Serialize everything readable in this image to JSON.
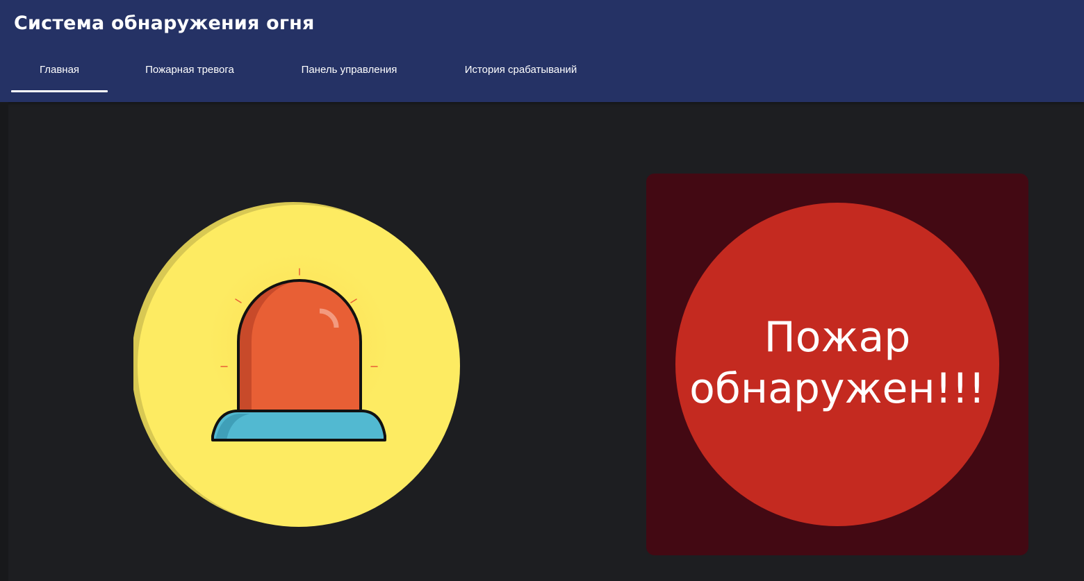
{
  "header": {
    "title": "Система обнаружения огня",
    "background": "#253265"
  },
  "nav": {
    "tabs": [
      {
        "label": "Главная",
        "active": true
      },
      {
        "label": "Пожарная тревога",
        "active": false
      },
      {
        "label": "Панель управления",
        "active": false
      },
      {
        "label": "История срабатываний",
        "active": false
      }
    ]
  },
  "alarm_icon": {
    "name": "siren-icon",
    "circle_color": "#fdeb62",
    "dome_color": "#e85f35",
    "base_color": "#52b9d1"
  },
  "status": {
    "message": "Пожар обнаружен!!!",
    "card_color": "#430913",
    "circle_color": "#c42a20"
  }
}
